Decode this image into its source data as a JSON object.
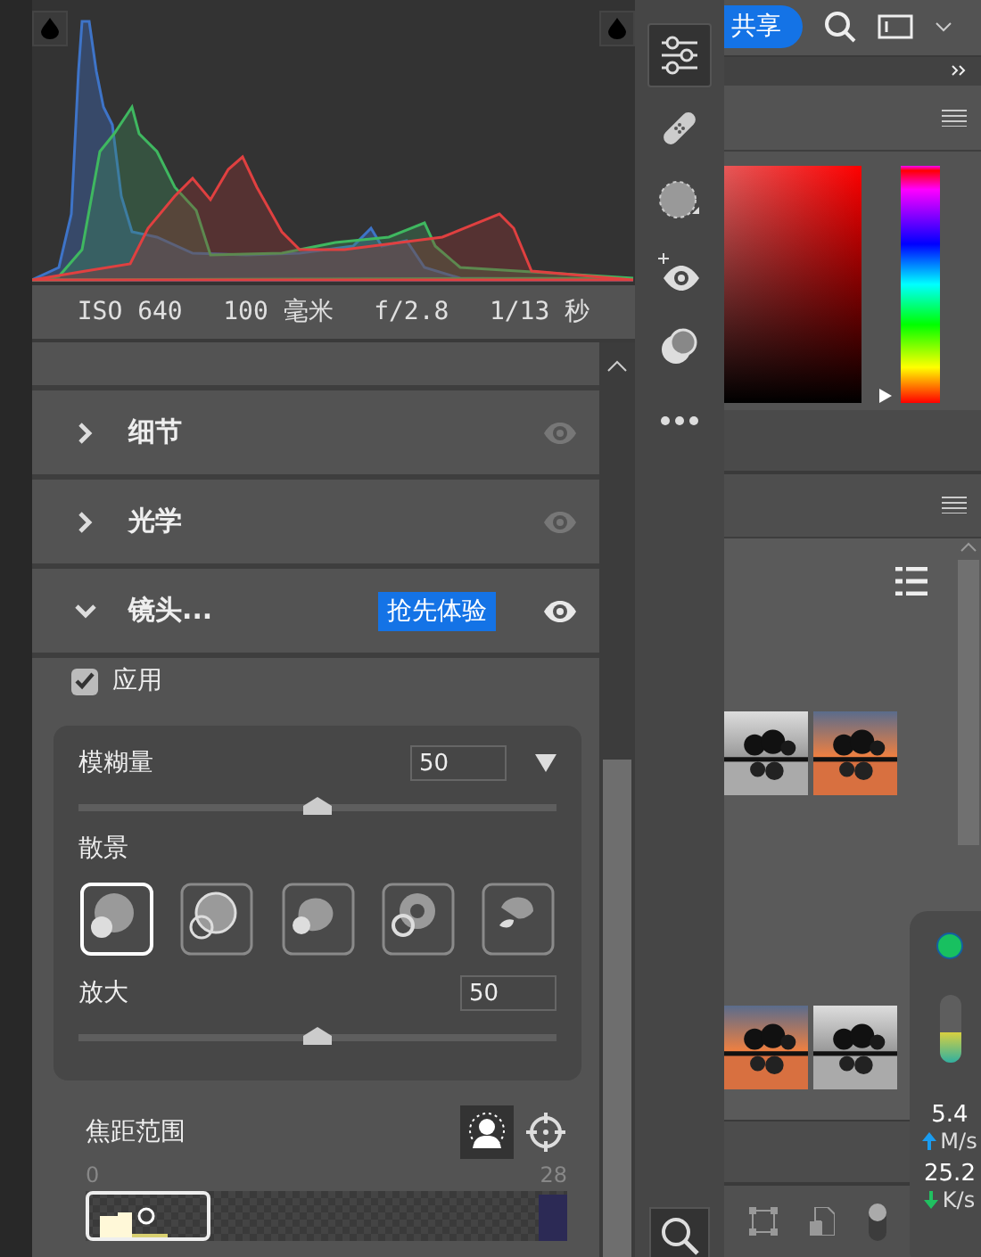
{
  "histogram": {
    "readouts": [
      "ISO 640",
      "100 毫米",
      "f/2.8",
      "1/13 秒"
    ]
  },
  "panels": [
    {
      "title": "细节",
      "expanded": false
    },
    {
      "title": "光学",
      "expanded": false
    },
    {
      "title": "镜头...",
      "expanded": true,
      "badge": "抢先体验"
    }
  ],
  "lens": {
    "apply": {
      "label": "应用",
      "checked": true
    },
    "blur": {
      "label": "模糊量",
      "value": "50",
      "level": 0.5
    },
    "bokeh": {
      "label": "散景",
      "options": [
        {
          "kind": "disc",
          "selected": true
        },
        {
          "kind": "ring",
          "selected": false
        },
        {
          "kind": "blob",
          "selected": false
        },
        {
          "kind": "donut",
          "selected": false
        },
        {
          "kind": "split",
          "selected": false
        }
      ]
    },
    "magnify": {
      "label": "放大",
      "value": "50",
      "level": 0.5
    },
    "focus": {
      "label": "焦距范围",
      "min": "0",
      "max": "28"
    }
  },
  "tools": [
    {
      "kind": "sliders",
      "selected": true
    },
    {
      "kind": "bandage",
      "selected": false
    },
    {
      "kind": "mask",
      "selected": false
    },
    {
      "kind": "redeye",
      "selected": false
    },
    {
      "kind": "presets",
      "selected": false
    },
    {
      "kind": "more",
      "selected": false
    }
  ],
  "dock": {
    "share_button": "共享",
    "hue": {
      "level": 0.03
    }
  },
  "net_monitor": {
    "level": 0.45,
    "upload": "5.4",
    "upload_unit": "M/s",
    "download": "25.2",
    "download_unit": "K/s"
  }
}
